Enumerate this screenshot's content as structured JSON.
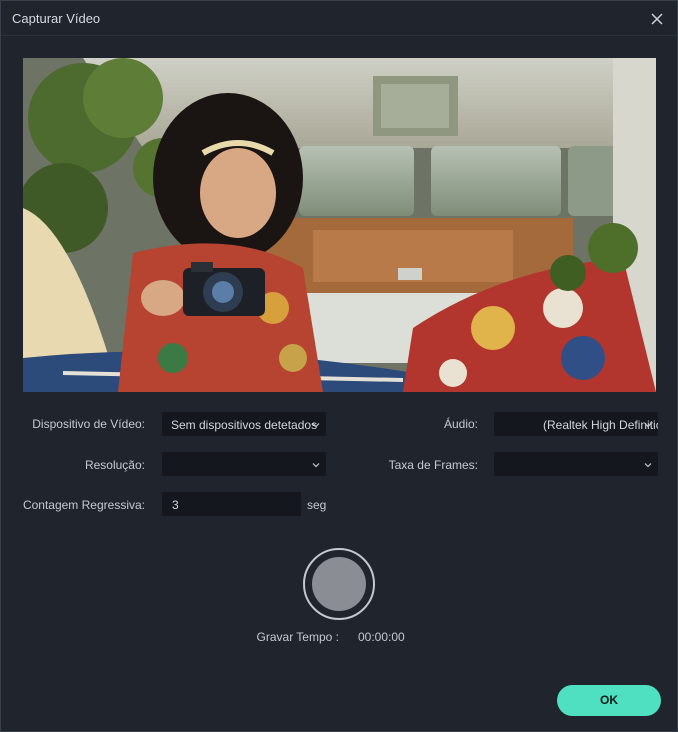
{
  "window": {
    "title": "Capturar Vídeo"
  },
  "form": {
    "video_device_label": "Dispositivo de Vídeo:",
    "video_device_value": "Sem dispositivos detetados",
    "audio_label": "Áudio:",
    "audio_value": "(Realtek High Definition Audio)",
    "resolution_label": "Resolução:",
    "resolution_value": "",
    "frame_rate_label": "Taxa de Frames:",
    "frame_rate_value": "",
    "countdown_label": "Contagem Regressiva:",
    "countdown_value": "3",
    "countdown_unit": "seg"
  },
  "record": {
    "time_label": "Gravar Tempo :",
    "time_value": "00:00:00"
  },
  "footer": {
    "ok_label": "OK"
  },
  "colors": {
    "accent": "#4fe0c2",
    "background": "#1f242d",
    "field": "#14181e"
  },
  "icons": {
    "close": "close-icon",
    "chevron": "chevron-down-icon",
    "record": "record-icon"
  }
}
